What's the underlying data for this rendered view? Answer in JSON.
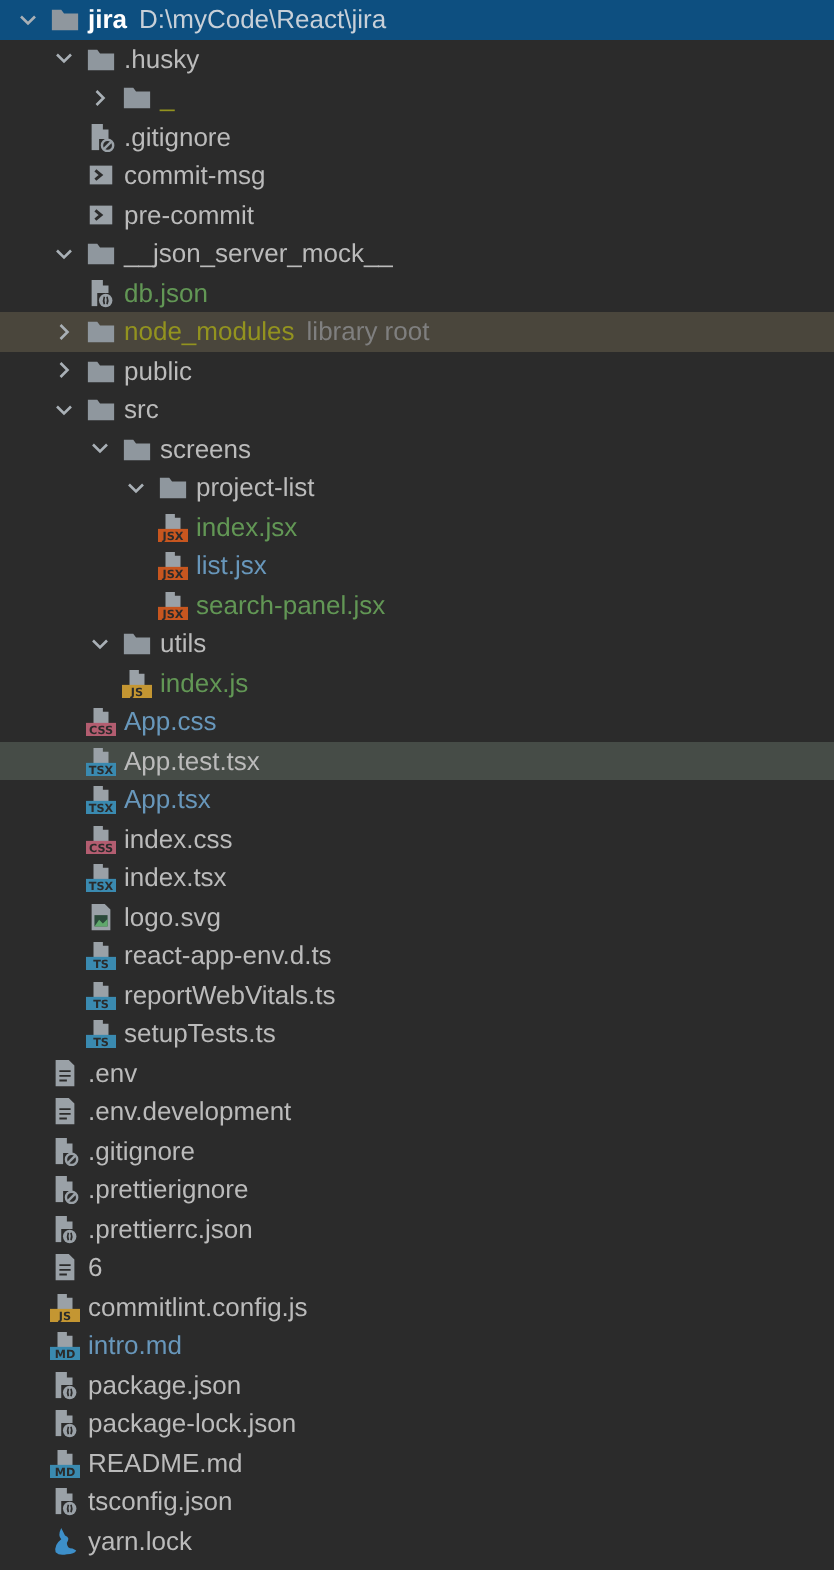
{
  "root": {
    "name": "jira",
    "path": "D:\\myCode\\React\\jira",
    "selected": true,
    "expanded": true
  },
  "tree": [
    {
      "name": ".husky",
      "kind": "folder",
      "expanded": true,
      "selected": false,
      "children": [
        {
          "name": "_",
          "kind": "folder",
          "expanded": false,
          "color": "#93931f",
          "selected": false
        },
        {
          "name": ".gitignore",
          "kind": "gitignore",
          "selected": false
        },
        {
          "name": "commit-msg",
          "kind": "shell",
          "selected": false
        },
        {
          "name": "pre-commit",
          "kind": "shell",
          "selected": false
        }
      ]
    },
    {
      "name": "__json_server_mock__",
      "kind": "folder",
      "expanded": true,
      "selected": false,
      "children": [
        {
          "name": "db.json",
          "kind": "json",
          "color": "#629755",
          "selected": false
        }
      ]
    },
    {
      "name": "node_modules",
      "kind": "folder",
      "expanded": false,
      "color": "#93931f",
      "library": "library root",
      "selected": false
    },
    {
      "name": "public",
      "kind": "folder",
      "expanded": false,
      "selected": false
    },
    {
      "name": "src",
      "kind": "folder",
      "expanded": true,
      "selected": false,
      "children": [
        {
          "name": "screens",
          "kind": "folder",
          "expanded": true,
          "selected": false,
          "children": [
            {
              "name": "project-list",
              "kind": "folder",
              "expanded": true,
              "selected": false,
              "children": [
                {
                  "name": "index.jsx",
                  "kind": "file",
                  "badge": {
                    "label": "JSX",
                    "color": "#c7561f"
                  },
                  "color": "#629755",
                  "selected": false
                },
                {
                  "name": "list.jsx",
                  "kind": "file",
                  "badge": {
                    "label": "JSX",
                    "color": "#c7561f"
                  },
                  "color": "#6897bb",
                  "selected": false
                },
                {
                  "name": "search-panel.jsx",
                  "kind": "file",
                  "badge": {
                    "label": "JSX",
                    "color": "#c7561f"
                  },
                  "color": "#629755",
                  "selected": false
                }
              ]
            }
          ]
        },
        {
          "name": "utils",
          "kind": "folder",
          "expanded": true,
          "selected": false,
          "children": [
            {
              "name": "index.js",
              "kind": "file",
              "badge": {
                "label": "JS",
                "color": "#c49632"
              },
              "color": "#629755",
              "selected": false
            }
          ]
        },
        {
          "name": "App.css",
          "kind": "file",
          "badge": {
            "label": "CSS",
            "color": "#b35d70"
          },
          "color": "#6897bb",
          "selected": false
        },
        {
          "name": "App.test.tsx",
          "kind": "file",
          "badge": {
            "label": "TSX",
            "color": "#3a8ab0"
          },
          "selected": true
        },
        {
          "name": "App.tsx",
          "kind": "file",
          "badge": {
            "label": "TSX",
            "color": "#3a8ab0"
          },
          "color": "#6897bb",
          "selected": false
        },
        {
          "name": "index.css",
          "kind": "file",
          "badge": {
            "label": "CSS",
            "color": "#b35d70"
          },
          "selected": false
        },
        {
          "name": "index.tsx",
          "kind": "file",
          "badge": {
            "label": "TSX",
            "color": "#3a8ab0"
          },
          "selected": false
        },
        {
          "name": "logo.svg",
          "kind": "image",
          "selected": false
        },
        {
          "name": "react-app-env.d.ts",
          "kind": "file",
          "badge": {
            "label": "TS",
            "color": "#3a8ab0"
          },
          "selected": false
        },
        {
          "name": "reportWebVitals.ts",
          "kind": "file",
          "badge": {
            "label": "TS",
            "color": "#3a8ab0"
          },
          "selected": false
        },
        {
          "name": "setupTests.ts",
          "kind": "file",
          "badge": {
            "label": "TS",
            "color": "#3a8ab0"
          },
          "selected": false
        }
      ]
    },
    {
      "name": ".env",
      "kind": "text",
      "selected": false
    },
    {
      "name": ".env.development",
      "kind": "text",
      "selected": false
    },
    {
      "name": ".gitignore",
      "kind": "gitignore",
      "selected": false
    },
    {
      "name": ".prettierignore",
      "kind": "gitignore",
      "selected": false
    },
    {
      "name": ".prettierrc.json",
      "kind": "json",
      "selected": false
    },
    {
      "name": "6",
      "kind": "text",
      "selected": false
    },
    {
      "name": "commitlint.config.js",
      "kind": "file",
      "badge": {
        "label": "JS",
        "color": "#c49632"
      },
      "selected": false
    },
    {
      "name": "intro.md",
      "kind": "file",
      "badge": {
        "label": "MD",
        "color": "#3a8ab0"
      },
      "color": "#6897bb",
      "selected": false
    },
    {
      "name": "package.json",
      "kind": "json",
      "selected": false
    },
    {
      "name": "package-lock.json",
      "kind": "json",
      "selected": false
    },
    {
      "name": "README.md",
      "kind": "file",
      "badge": {
        "label": "MD",
        "color": "#3a8ab0"
      },
      "selected": false
    },
    {
      "name": "tsconfig.json",
      "kind": "json",
      "selected": false
    },
    {
      "name": "yarn.lock",
      "kind": "yarn",
      "selected": false
    }
  ]
}
